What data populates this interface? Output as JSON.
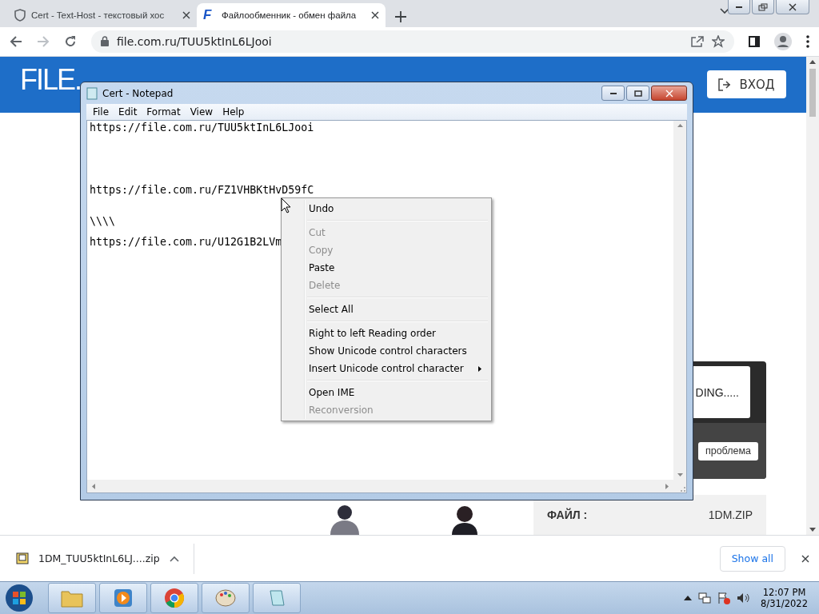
{
  "browser": {
    "tabs": [
      {
        "title": "Cert - Text-Host - текстовый хос",
        "selected": false
      },
      {
        "title": "Файлообменник - обмен файла",
        "favicon": "F",
        "selected": true
      }
    ],
    "address": "file.com.ru/TUU5ktInL6LJooi"
  },
  "site": {
    "logo": "FILE.",
    "login": "ВХОД",
    "loading": "DING.....",
    "problem_button": "проблема",
    "file_label": "ФАЙЛ :",
    "file_value": "1DM.ZIP"
  },
  "notepad": {
    "title": "Cert - Notepad",
    "menu": [
      "File",
      "Edit",
      "Format",
      "View",
      "Help"
    ],
    "text_blocks": [
      "https://file.com.ru/TUU5ktInL6LJooi\n\n\n\n\n\nhttps://file.com.ru/FZ1VHBKtHvD59fC",
      "\\\\\\\\\n\nhttps://file.com.ru/U12G1B2LVm"
    ]
  },
  "context_menu": {
    "groups": [
      [
        {
          "label": "Undo",
          "disabled": false,
          "submenu": false
        }
      ],
      [
        {
          "label": "Cut",
          "disabled": true,
          "submenu": false
        },
        {
          "label": "Copy",
          "disabled": true,
          "submenu": false
        },
        {
          "label": "Paste",
          "disabled": false,
          "submenu": false
        },
        {
          "label": "Delete",
          "disabled": true,
          "submenu": false
        }
      ],
      [
        {
          "label": "Select All",
          "disabled": false,
          "submenu": false
        }
      ],
      [
        {
          "label": "Right to left Reading order",
          "disabled": false,
          "submenu": false
        },
        {
          "label": "Show Unicode control characters",
          "disabled": false,
          "submenu": false
        },
        {
          "label": "Insert Unicode control character",
          "disabled": false,
          "submenu": true
        }
      ],
      [
        {
          "label": "Open IME",
          "disabled": false,
          "submenu": false
        },
        {
          "label": "Reconversion",
          "disabled": true,
          "submenu": false
        }
      ]
    ]
  },
  "download_bar": {
    "file": "1DM_TUU5ktInL6LJ....zip",
    "show_all": "Show all"
  },
  "taskbar": {
    "time": "12:07 PM",
    "date": "8/31/2022"
  }
}
